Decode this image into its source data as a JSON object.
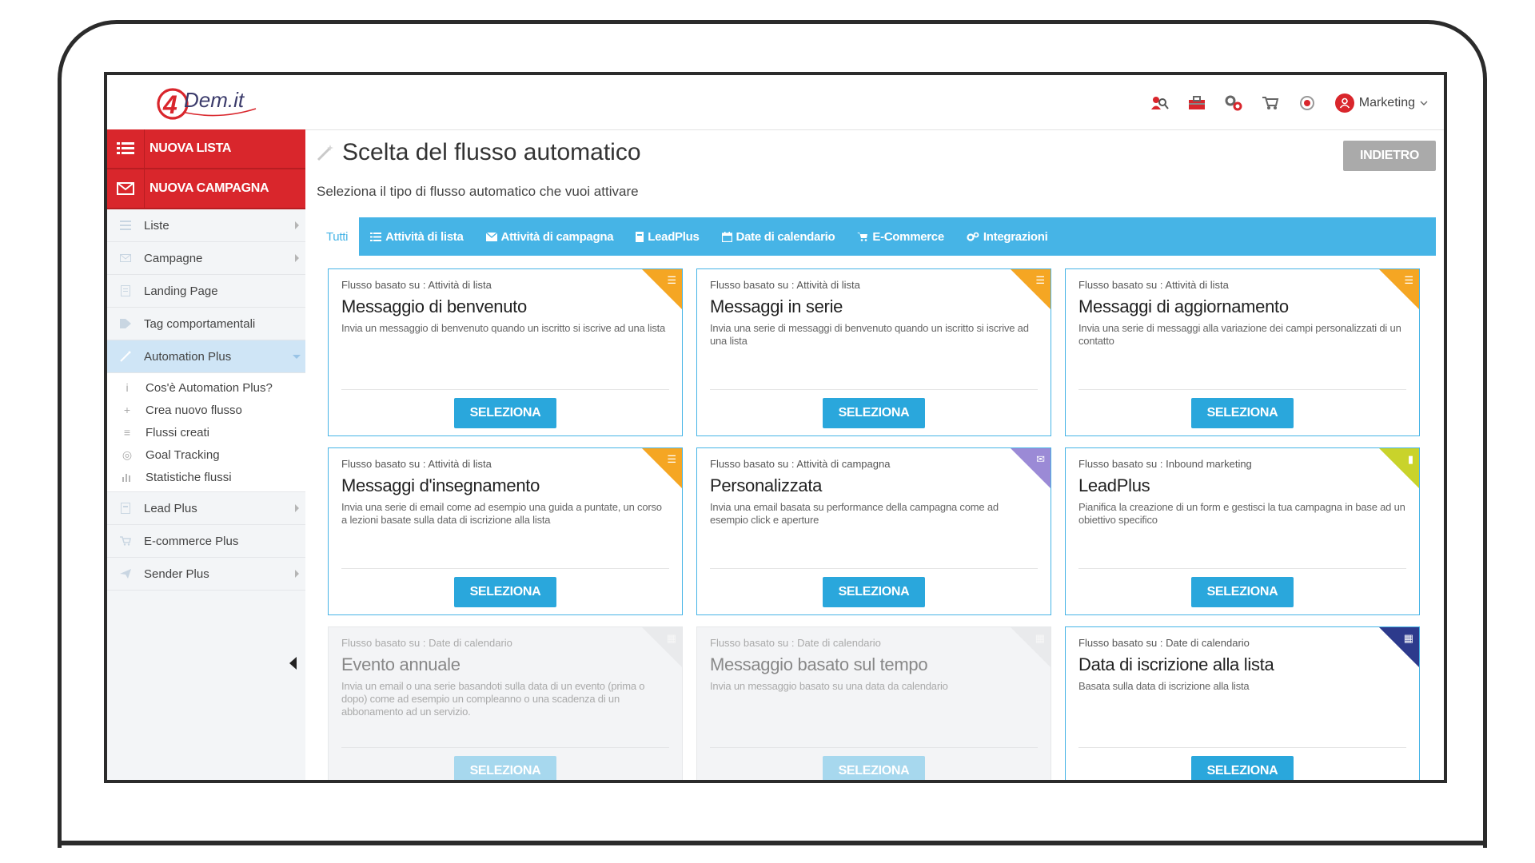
{
  "brand": {
    "logo_text": "Dem.it",
    "logo_mark": "4"
  },
  "header": {
    "account_label": "Marketing"
  },
  "sidebar": {
    "cta": [
      {
        "label": "NUOVA LISTA",
        "icon": "list-icon"
      },
      {
        "label": "NUOVA CAMPAGNA",
        "icon": "envelope-icon"
      }
    ],
    "items": [
      {
        "label": "Liste"
      },
      {
        "label": "Campagne"
      },
      {
        "label": "Landing Page"
      },
      {
        "label": "Tag comportamentali"
      },
      {
        "label": "Automation Plus"
      },
      {
        "label": "Lead Plus"
      },
      {
        "label": "E-commerce Plus"
      },
      {
        "label": "Sender Plus"
      }
    ],
    "automation_sub": [
      {
        "label": "Cos'è Automation Plus?"
      },
      {
        "label": "Crea nuovo flusso"
      },
      {
        "label": "Flussi creati"
      },
      {
        "label": "Goal Tracking"
      },
      {
        "label": "Statistiche flussi"
      }
    ]
  },
  "main": {
    "title": "Scelta del flusso automatico",
    "back_label": "INDIETRO",
    "subtitle": "Seleziona il tipo di flusso automatico che vuoi attivare",
    "tabs": [
      {
        "label": "Tutti"
      },
      {
        "label": "Attività di lista"
      },
      {
        "label": "Attività di campagna"
      },
      {
        "label": "LeadPlus"
      },
      {
        "label": "Date di calendario"
      },
      {
        "label": "E-Commerce"
      },
      {
        "label": "Integrazioni"
      }
    ],
    "select_label": "SELEZIONA",
    "cards": [
      {
        "based": "Flusso basato su : Attività di lista",
        "title": "Messaggio di benvenuto",
        "desc": "Invia un messaggio di benvenuto quando un iscritto si iscrive ad una lista"
      },
      {
        "based": "Flusso basato su : Attività di lista",
        "title": "Messaggi in serie",
        "desc": "Invia una serie di messaggi di benvenuto quando un iscritto si iscrive ad una lista"
      },
      {
        "based": "Flusso basato su : Attività di lista",
        "title": "Messaggi di aggiornamento",
        "desc": "Invia una serie di messaggi alla variazione dei campi personalizzati di un contatto"
      },
      {
        "based": "Flusso basato su : Attività di lista",
        "title": "Messaggi d'insegnamento",
        "desc": "Invia una serie di email come ad esempio una guida a puntate, un corso a lezioni basate sulla data di iscrizione alla lista"
      },
      {
        "based": "Flusso basato su : Attività di campagna",
        "title": "Personalizzata",
        "desc": "Invia una email basata su performance della campagna come ad esempio click e aperture"
      },
      {
        "based": "Flusso basato su : Inbound marketing",
        "title": "LeadPlus",
        "desc": "Pianifica la creazione di un form e gestisci la tua campagna in base ad un obiettivo specifico"
      },
      {
        "based": "Flusso basato su : Date di calendario",
        "title": "Evento annuale",
        "desc": "Invia un email o una serie basandoti sulla data di un evento (prima o dopo) come ad esempio un compleanno o una scadenza di un abbonamento ad un servizio."
      },
      {
        "based": "Flusso basato su : Date di calendario",
        "title": "Messaggio basato sul tempo",
        "desc": "Invia un messaggio basato su una data da calendario"
      },
      {
        "based": "Flusso basato su : Date di calendario",
        "title": "Data di iscrizione alla lista",
        "desc": "Basata sulla data di iscrizione alla lista"
      }
    ]
  },
  "colors": {
    "brand_red": "#d9262c",
    "tab_blue": "#46b4e6",
    "button_blue": "#2aa7dc",
    "corner_list": "#f5a623",
    "corner_campaign": "#9b8ad6",
    "corner_lead": "#c9d32b",
    "corner_calendar": "#2d3a8c"
  }
}
